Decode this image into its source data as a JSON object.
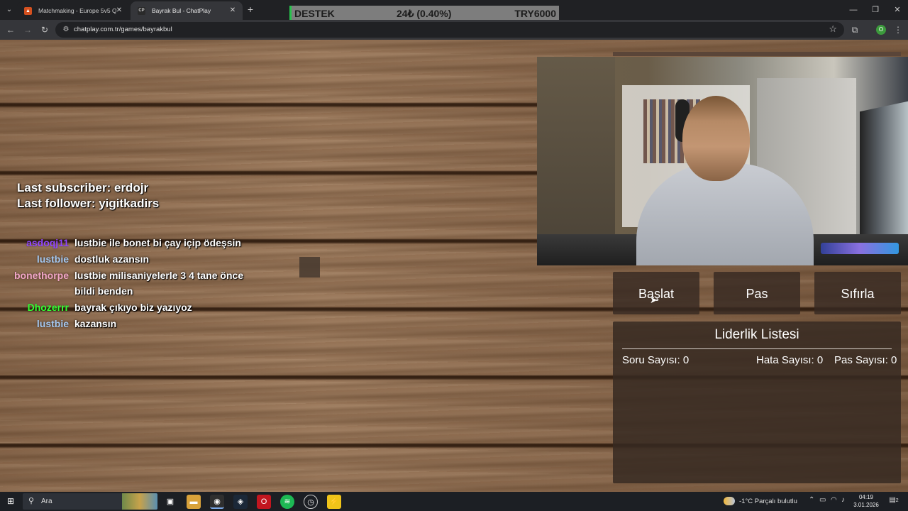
{
  "browser": {
    "tabs": [
      {
        "title": "Matchmaking - Europe 5v5 Qu",
        "active": false
      },
      {
        "title": "Bayrak Bul - ChatPlay",
        "active": true
      }
    ],
    "tab2_favicon_text": "CP",
    "url": "chatplay.com.tr/games/bayrakbul",
    "profile_letter": "O"
  },
  "ticker": {
    "left": "DESTEK",
    "middle": "24₺ (0.40%)",
    "right": "TRY6000",
    "accent": "#27c24c"
  },
  "stream_overlay": {
    "last_subscriber": "Last subscriber: erdojr",
    "last_follower": "Last follower: yigitkadirs"
  },
  "chat": [
    {
      "user": "asdoqj11",
      "color": "#9146ff",
      "message": "lustbie ile bonet bi çay içip ödeşsin"
    },
    {
      "user": "lustbie",
      "color": "#a5c8f0",
      "message": "dostluk azansın"
    },
    {
      "user": "bonethorpe",
      "color": "#f2a6c8",
      "message": "lustbie milisaniyelerle 3 4 tane önce bildi benden"
    },
    {
      "user": "Dhozerrr",
      "color": "#33ff33",
      "message": "bayrak çıkıyo biz yazıyoz"
    },
    {
      "user": "lustbie",
      "color": "#a5c8f0",
      "message": "kazansın"
    }
  ],
  "game": {
    "buttons": {
      "start": "Başlat",
      "pass": "Pas",
      "reset": "Sıfırla"
    },
    "leaderboard": {
      "title": "Liderlik Listesi",
      "question_count": "Soru Sayısı: 0",
      "error_count": "Hata Sayısı: 0",
      "pass_count": "Pas Sayısı: 0"
    }
  },
  "taskbar": {
    "search_placeholder": "Ara",
    "weather": "-1°C  Parçalı bulutlu",
    "time": "04:19",
    "date": "3.01.2026",
    "notification_count": "2"
  }
}
